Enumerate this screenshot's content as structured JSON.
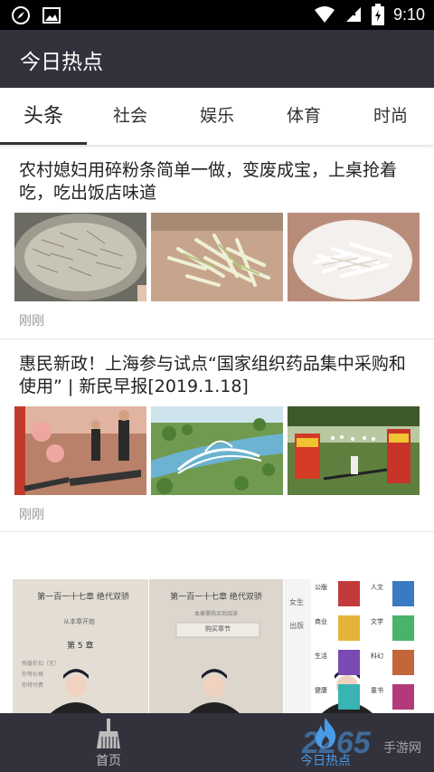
{
  "status_bar": {
    "time": "9:10",
    "icons": [
      "compass-icon",
      "image-icon",
      "wifi-icon",
      "signal-icon",
      "battery-icon"
    ]
  },
  "app": {
    "title": "今日热点"
  },
  "tabs": [
    {
      "label": "头条",
      "active": true
    },
    {
      "label": "社会",
      "active": false
    },
    {
      "label": "娱乐",
      "active": false
    },
    {
      "label": "体育",
      "active": false
    },
    {
      "label": "时尚",
      "active": false
    }
  ],
  "articles": [
    {
      "title": "农村媳妇用碎粉条简单一做，变废成宝，上桌抢着吃，吃出饭店味道",
      "time": "刚刚",
      "images": [
        "noodle-bowl-image",
        "noodle-board-image",
        "noodle-plate-image"
      ]
    },
    {
      "title": "惠民新政！上海参与试点“国家组织药品集中采购和使用” | 新民早报[2019.1.18]",
      "time": "刚刚",
      "images": [
        "gym-treadmill-image",
        "bridge-park-image",
        "festival-crowd-image"
      ]
    }
  ],
  "banner": {
    "panel_1_heading": "第一百一十七章 绝代双骄",
    "panel_1_lines": [
      "从本章开始",
      "第 5 章",
      "残番折扣（至）",
      "你等价格",
      "你将付费"
    ],
    "panel_2_heading": "第一百一十七章 绝代双骄",
    "panel_2_sub": "本章需购买后阅读",
    "panel_2_button": "购买章节",
    "panel_3_side": [
      "女生",
      "出版"
    ],
    "panel_3_cats": [
      "公版",
      "人文",
      "商业",
      "文学",
      "生活",
      "科幻",
      "健康",
      "童书"
    ]
  },
  "bottom_nav": [
    {
      "label": "首页",
      "icon": "broom-icon",
      "active": false
    },
    {
      "label": "今日热点",
      "icon": "flame-icon",
      "active": true
    }
  ],
  "watermark": {
    "logo": "2265",
    "text": "手游网"
  },
  "colors": {
    "app_bar": "#32323c",
    "nav_active": "#4a9be8",
    "nav_inactive": "#bdbdbd"
  }
}
